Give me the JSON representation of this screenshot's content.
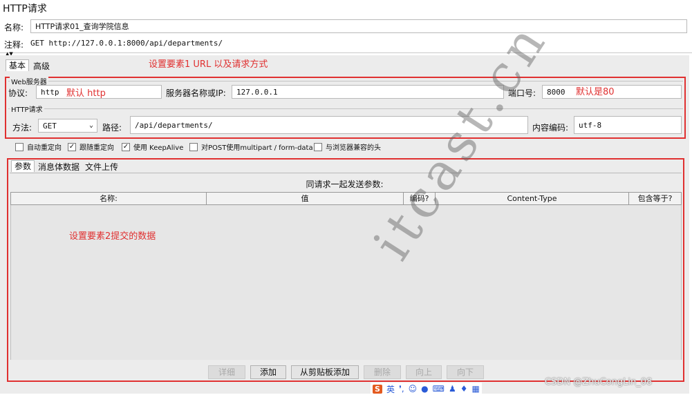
{
  "window": {
    "title": "HTTP请求"
  },
  "form": {
    "name_label": "名称:",
    "name_value": "HTTP请求01_查询学院信息",
    "comment_label": "注释:",
    "comment_value": "GET http://127.0.0.1:8000/api/departments/"
  },
  "tabs": {
    "basic": "基本",
    "advanced": "高级"
  },
  "annotations": {
    "url_method": "设置要素1 URL 以及请求方式",
    "default_http": "默认 http",
    "default_80": "默认是80",
    "data": "设置要素2提交的数据"
  },
  "web_server": {
    "group_label": "Web服务器",
    "protocol_label": "协议:",
    "protocol_value": "http",
    "server_label": "服务器名称或IP:",
    "server_value": "127.0.0.1",
    "port_label": "端口号:",
    "port_value": "8000"
  },
  "http_request": {
    "group_label": "HTTP请求",
    "method_label": "方法:",
    "method_value": "GET",
    "path_label": "路径:",
    "path_value": "/api/departments/",
    "encoding_label": "内容编码:",
    "encoding_value": "utf-8"
  },
  "options": [
    {
      "label": "自动重定向",
      "checked": false
    },
    {
      "label": "跟随重定向",
      "checked": true
    },
    {
      "label": "使用 KeepAlive",
      "checked": true
    },
    {
      "label": "对POST使用multipart / form-data",
      "checked": false
    },
    {
      "label": "与浏览器兼容的头",
      "checked": false
    }
  ],
  "param_tabs": {
    "params": "参数",
    "body": "消息体数据",
    "files": "文件上传"
  },
  "params_table": {
    "caption": "同请求一起发送参数:",
    "columns": [
      "名称:",
      "值",
      "编码?",
      "Content-Type",
      "包含等于?"
    ]
  },
  "buttons": {
    "detail": "详细",
    "add": "添加",
    "add_clipboard": "从剪贴板添加",
    "delete": "删除",
    "up": "向上",
    "down": "向下"
  },
  "watermark": {
    "text": "itcast.cn",
    "credit": "CSDN @ZhuCongLin_08"
  },
  "ime": {
    "lang": "英"
  },
  "colors": {
    "annotation_red": "#e03030",
    "panel": "#ececec"
  }
}
